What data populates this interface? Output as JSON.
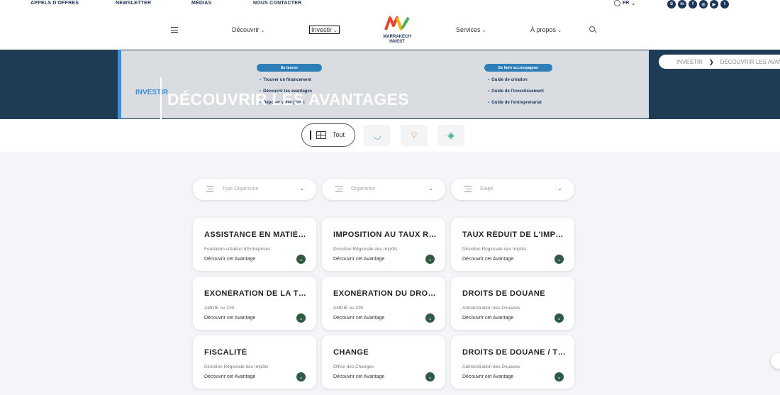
{
  "topbar": {
    "links": [
      "APPELS D'OFFRES",
      "NEWSLETTER",
      "MÉDIAS",
      "NOUS CONTACTER"
    ],
    "lang": "FR",
    "socials": [
      "skype-icon",
      "linkedin-icon",
      "facebook-icon",
      "instagram-icon",
      "youtube-icon",
      "twitter-icon"
    ]
  },
  "nav": {
    "items": [
      {
        "label": "Découvrir",
        "chev": "⌄"
      },
      {
        "label": "Investir",
        "chev": "⌄"
      },
      {
        "label": "Services",
        "chev": "⌄"
      },
      {
        "label": "À propos",
        "chev": "⌄"
      }
    ],
    "logo_line1": "MARRAKECH",
    "logo_line2": "INVEST"
  },
  "hero": {
    "subtitle": "INVESTIR",
    "title": "DÉCOUVRIR LES AVANTAGES",
    "menu_left_title": "Se lancer",
    "menu_left": [
      "Trouver un financement",
      "Découvrir les avantages",
      "Déposer votre projet"
    ],
    "menu_right_title": "Se faire accompagner",
    "menu_right": [
      "Guide de création",
      "Guide de l'investissement",
      "Guide de l'entreprenariat"
    ],
    "breadcrumb": [
      "INVESTIR",
      "DÉCOUVRIR LES AVANTAGES"
    ],
    "breadcrumb_sep": "❯"
  },
  "filters": {
    "tab_all": "Tout",
    "selects": [
      {
        "placeholder": "Type Organisme",
        "chev": "⌄"
      },
      {
        "placeholder": "Organisme",
        "chev": "⌄"
      },
      {
        "placeholder": "Étape",
        "chev": "⌄"
      }
    ]
  },
  "cards": [
    {
      "title": "ASSISTANCE EN MATIÈRE DE FINANCEMENT",
      "org": "Fondation création d'Entreprises",
      "cta": "Découvrir cet Avantage"
    },
    {
      "title": "IMPOSITION AU TAUX RÉDUIT",
      "org": "Direction Régionale des Impôts",
      "cta": "Découvrir cet Avantage"
    },
    {
      "title": "TAUX RÉDUIT DE L'IMPÔT",
      "org": "Direction Régionale des Impôts",
      "cta": "Découvrir cet Avantage"
    },
    {
      "title": "EXONÉRATION DE LA TVA",
      "org": "AMDIE ou CRI",
      "cta": "Découvrir cet Avantage"
    },
    {
      "title": "EXONÉRATION DU DROIT D'IMPORTATION",
      "org": "AMDIE ou CRI",
      "cta": "Découvrir cet Avantage"
    },
    {
      "title": "DROITS DE DOUANE",
      "org": "Administration des Douanes",
      "cta": "Découvrir cet Avantage"
    },
    {
      "title": "FISCALITÉ",
      "org": "Direction Régionale des Impôts",
      "cta": "Découvrir cet Avantage"
    },
    {
      "title": "CHANGE",
      "org": "Office des Changes",
      "cta": "Découvrir cet Avantage"
    },
    {
      "title": "DROITS DE DOUANE / TVA",
      "org": "Administration des Douanes",
      "cta": "Découvrir cet Avantage"
    }
  ],
  "colors": {
    "navy": "#1e3c55",
    "accent": "#3b8fd6",
    "green": "#2f5a45"
  }
}
